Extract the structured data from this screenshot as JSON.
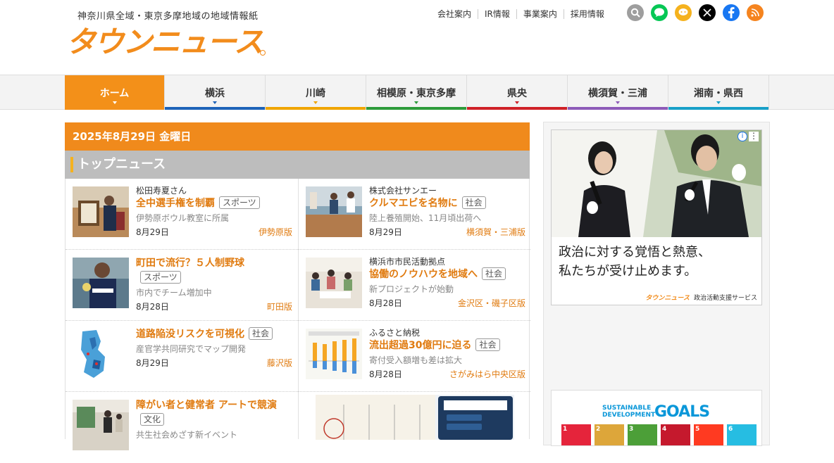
{
  "header": {
    "tagline": "神奈川県全域・東京多摩地域の地域情報紙",
    "logo_text": "タウンニュース",
    "links": [
      "会社案内",
      "IR情報",
      "事業案内",
      "採用情報"
    ],
    "social_icons": [
      "search-icon",
      "line-icon",
      "chat-icon",
      "x-icon",
      "facebook-icon",
      "rss-icon"
    ]
  },
  "nav": {
    "items": [
      {
        "label": "ホーム",
        "color": "#f39019",
        "active": true
      },
      {
        "label": "横浜",
        "color": "#1e63b8"
      },
      {
        "label": "川崎",
        "color": "#f0a500"
      },
      {
        "label": "相模原・東京多摩",
        "color": "#2d9b3a"
      },
      {
        "label": "県央",
        "color": "#cf2127"
      },
      {
        "label": "横須賀・三浦",
        "color": "#8d5bb8"
      },
      {
        "label": "湘南・県西",
        "color": "#18a0c8"
      }
    ]
  },
  "main": {
    "date": "2025年8月29日 金曜日",
    "section_title": "トップニュース",
    "news": [
      {
        "who": "松田寿夏さん",
        "headline": "全中選手権を制覇",
        "tag": "スポーツ",
        "sub": "伊勢原ボウル教室に所属",
        "date": "8月29日",
        "edition": "伊勢原版"
      },
      {
        "who": "株式会社サンエー",
        "headline": "クルマエビを名物に",
        "tag": "社会",
        "sub": "陸上養殖開始、11月頃出荷へ",
        "date": "8月29日",
        "edition": "横須賀・三浦版"
      },
      {
        "who": "",
        "headline": "町田で流行？５人制野球",
        "tag": "スポーツ",
        "sub": "市内でチーム増加中",
        "date": "8月28日",
        "edition": "町田版"
      },
      {
        "who": "横浜市市民活動拠点",
        "headline": "協働のノウハウを地域へ",
        "tag": "社会",
        "sub": "新プロジェクトが始動",
        "date": "8月28日",
        "edition": "金沢区・磯子区版"
      },
      {
        "who": "",
        "headline": "道路陥没リスクを可視化",
        "tag": "社会",
        "sub": "産官学共同研究でマップ開発",
        "date": "8月29日",
        "edition": "藤沢版"
      },
      {
        "who": "ふるさと納税",
        "headline": "流出超過30億円に迫る",
        "tag": "社会",
        "sub": "寄付受入額増も差は拡大",
        "date": "8月28日",
        "edition": "さがみはら中央区版"
      },
      {
        "who": "",
        "headline": "障がい者と健常者 アートで競演",
        "tag": "文化",
        "sub": "共生社会めざす新イベント",
        "date": "",
        "edition": ""
      }
    ]
  },
  "sidebar": {
    "ad1": {
      "copy_line1": "政治に対する覚悟と熱意、",
      "copy_line2": "私たちが受け止めます。",
      "footer_logo": "タウンニュース",
      "footer_text": "政治活動支援サービス"
    },
    "ad2": {
      "title_line1": "SUSTAINABLE",
      "title_line2": "DEVELOPMENT",
      "goals": "GOALS",
      "tiles": [
        {
          "num": "1",
          "color": "#e5243b"
        },
        {
          "num": "2",
          "color": "#dda63a"
        },
        {
          "num": "3",
          "color": "#4c9f38"
        },
        {
          "num": "4",
          "color": "#c5192d"
        },
        {
          "num": "5",
          "color": "#ff3a21"
        },
        {
          "num": "6",
          "color": "#26bde2"
        }
      ]
    }
  }
}
